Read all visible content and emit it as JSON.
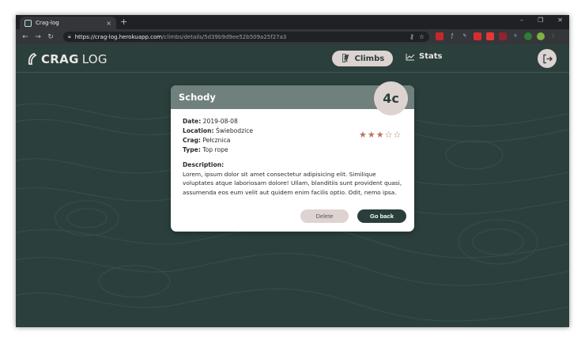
{
  "browser": {
    "tab_title": "Crag-log",
    "tab_close": "×",
    "new_tab": "+",
    "url_host": "https://crag-log.herokuapp.com",
    "url_path": "/climbs/details/5d39b9d9ee52b509a25f27a3",
    "window_controls": [
      "–",
      "❐",
      "✕"
    ]
  },
  "app": {
    "logo_bold": "CRAG",
    "logo_light": "LOG",
    "nav": {
      "climbs_label": "Climbs",
      "stats_label": "Stats"
    }
  },
  "climb": {
    "name": "Schody",
    "grade": "4c",
    "fields": [
      {
        "label": "Date:",
        "value": "2019-08-08"
      },
      {
        "label": "Location:",
        "value": "Świebodzice"
      },
      {
        "label": "Crag:",
        "value": "Pełcznica"
      },
      {
        "label": "Type:",
        "value": "Top rope"
      }
    ],
    "rating": 3,
    "rating_max": 5,
    "description_label": "Description:",
    "description": "Lorem, ipsum dolor sit amet consectetur adipisicing elit. Similique voluptates atque laboriosam dolore! Ullam, blanditiis sunt provident quasi, assumenda eos eum velit aut quidem enim facilis optio. Odit, nemo ipsa.",
    "delete_label": "Delete",
    "back_label": "Go back"
  },
  "colors": {
    "background": "#2b403d",
    "accent_light": "#ddd3d1",
    "card_header": "#6f807d",
    "star": "#b8735e"
  }
}
